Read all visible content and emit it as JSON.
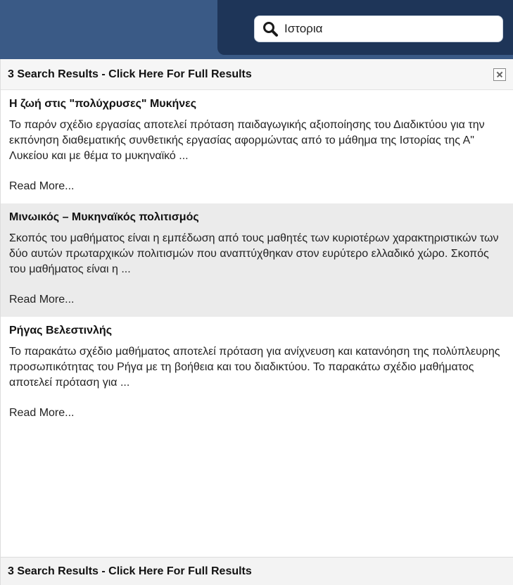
{
  "search": {
    "query": "Ιστορια",
    "icon": "search-icon"
  },
  "results_panel": {
    "header_text": "3 Search Results - Click Here For Full Results",
    "footer_text": "3 Search Results - Click Here For Full Results",
    "results": [
      {
        "title": "Η ζωή στις \"πολύχρυσες\" Μυκήνες",
        "snippet": "Το παρόν σχέδιο εργασίας αποτελεί πρόταση παιδαγωγικής αξιοποίησης του Διαδικτύου για την εκπόνηση διαθεματικής συνθετικής εργασίας αφορμώντας από το μάθημα της Ιστορίας της Α\" Λυκείου και με θέμα το μυκηναϊκό ...",
        "read_more": "Read More..."
      },
      {
        "title": "Μινωικός – Μυκηναϊκός πολιτισμός",
        "snippet": "Σκοπός του μαθήματος είναι η εμπέδωση από τους μαθητές των κυριοτέρων χαρακτηριστικών των δύο αυτών πρωταρχικών πολιτισμών που αναπτύχθηκαν στον ευρύτερο ελλαδικό χώρο. Σκοπός του μαθήματος είναι η ...",
        "read_more": "Read More..."
      },
      {
        "title": "Ρήγας Βελεστινλής",
        "snippet": "Το παρακάτω σχέδιο μαθήματος αποτελεί πρόταση για ανίχνευση και κατανόηση της πολύπλευρης προσωπικότητας του Ρήγα με τη βοήθεια και του διαδικτύου. Το παρακάτω σχέδιο μαθήματος αποτελεί πρόταση για ...",
        "read_more": "Read More..."
      }
    ]
  },
  "colors": {
    "topbar": "#3a5a86",
    "topbar_dark": "#1e3558",
    "alt_row": "#ebebeb"
  }
}
